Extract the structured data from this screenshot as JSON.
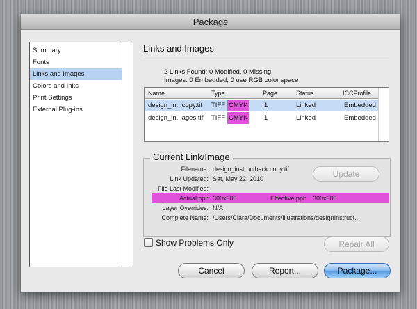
{
  "window": {
    "title": "Package"
  },
  "sidebar": {
    "items": [
      {
        "label": "Summary",
        "selected": false
      },
      {
        "label": "Fonts",
        "selected": false
      },
      {
        "label": "Links and Images",
        "selected": true
      },
      {
        "label": "Colors and Inks",
        "selected": false
      },
      {
        "label": "Print Settings",
        "selected": false
      },
      {
        "label": "External Plug-ins",
        "selected": false
      }
    ]
  },
  "main": {
    "section_title": "Links and Images",
    "summary_line1": "2 Links Found; 0 Modified, 0 Missing",
    "summary_line2": "Images: 0 Embedded, 0 use RGB color space",
    "table": {
      "headers": {
        "name": "Name",
        "type": "Type",
        "page": "Page",
        "status": "Status",
        "icc": "ICCProfile"
      },
      "rows": [
        {
          "name": "design_in...copy.tif",
          "type": "TIFF",
          "mode": "CMYK",
          "page": "1",
          "status": "Linked",
          "icc": "Embedded",
          "selected": true
        },
        {
          "name": "design_in...ages.tif",
          "type": "TIFF",
          "mode": "CMYK",
          "page": "1",
          "status": "Linked",
          "icc": "Embedded",
          "selected": false
        }
      ]
    },
    "current": {
      "title": "Current Link/Image",
      "filename_label": "Filename:",
      "filename": "design_instructback copy.tif",
      "updated_label": "Link Updated:",
      "updated": "Sat, May 22, 2010",
      "modified_label": "File Last Modified:",
      "actual_ppi_label": "Actual ppi:",
      "actual_ppi": "300x300",
      "effective_ppi_label": "Effective ppi:",
      "effective_ppi": "300x300",
      "layer_label": "Layer Overrides:",
      "layer": "N/A",
      "complete_label": "Complete Name:",
      "complete": "/Users/Ciara/Documents/illustrations/designInstruct...",
      "update_button": "Update"
    },
    "show_problems_label": "Show Problems Only",
    "show_problems_checked": false,
    "repair_all": "Repair All"
  },
  "footer": {
    "cancel": "Cancel",
    "report": "Report...",
    "package": "Package..."
  },
  "colors": {
    "highlight_magenta": "#e052dc",
    "selection_blue": "#b7d3f3",
    "default_button_blue": "#7cb4ea"
  }
}
